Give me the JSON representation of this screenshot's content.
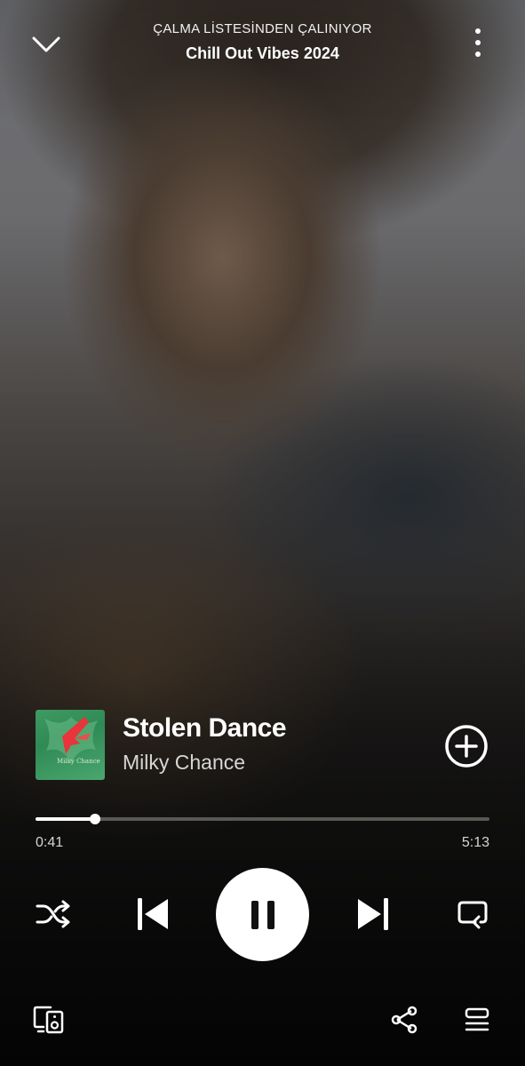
{
  "header": {
    "context_label": "ÇALMA LİSTESİNDEN ÇALINIYOR",
    "playlist_name": "Chill Out Vibes 2024"
  },
  "track": {
    "title": "Stolen Dance",
    "artist": "Milky Chance",
    "cover_text": "Milky Chance"
  },
  "progress": {
    "elapsed": "0:41",
    "total": "5:13",
    "fraction": 0.131
  },
  "controls": {
    "shuffle": "shuffle-icon",
    "previous": "skip-previous-icon",
    "play_state": "pause-icon",
    "next": "skip-next-icon",
    "repeat": "repeat-icon"
  },
  "bottom_bar": {
    "devices": "connect-device-icon",
    "share": "share-icon",
    "queue": "queue-icon"
  },
  "colors": {
    "accent": "#ffffff",
    "secondary_text": "#d6d6d6"
  }
}
